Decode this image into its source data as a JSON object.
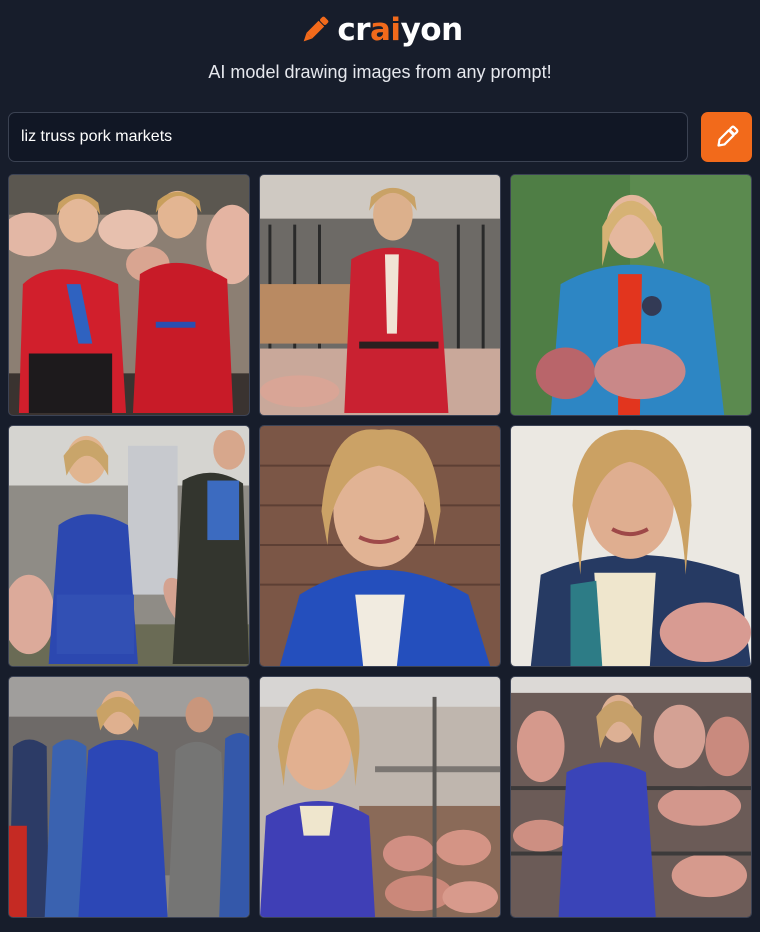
{
  "header": {
    "logo_text_start": "cr",
    "logo_text_accent": "ai",
    "logo_text_end": "yon",
    "logo_icon": "pencil-icon",
    "tagline": "AI model drawing images from any prompt!"
  },
  "search": {
    "value": "liz truss pork markets",
    "button_icon": "pencil-icon"
  },
  "colors": {
    "background": "#171d2b",
    "accent": "#f26a1b",
    "input_background": "#111725",
    "border": "#3c4355"
  },
  "results": [
    {
      "id": "result-1",
      "scene": "two women in red jackets among pig carcasses"
    },
    {
      "id": "result-2",
      "scene": "woman in red jacket in a butcher market"
    },
    {
      "id": "result-3",
      "scene": "woman in blue jacket holding a pork joint"
    },
    {
      "id": "result-4",
      "scene": "woman in blue suit carrying pigs at a market"
    },
    {
      "id": "result-5",
      "scene": "close portrait of a woman in a blue jacket"
    },
    {
      "id": "result-6",
      "scene": "portrait of a woman in a navy jacket holding pork"
    },
    {
      "id": "result-7",
      "scene": "woman in blue walking with a crowd"
    },
    {
      "id": "result-8",
      "scene": "woman in blue beside meat counters"
    },
    {
      "id": "result-9",
      "scene": "woman in blue dress among meat displays"
    }
  ]
}
